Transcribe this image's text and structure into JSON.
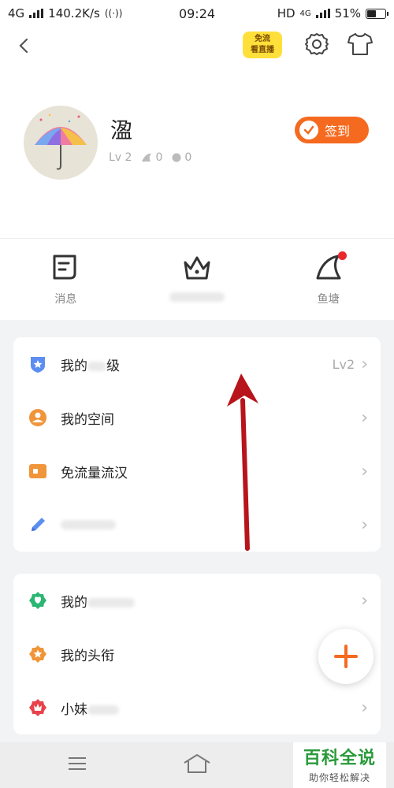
{
  "status_bar": {
    "network": "4G",
    "speed": "140.2K/s",
    "time": "09:24",
    "hd": "HD",
    "net_right": "4G",
    "battery": "51%",
    "battery_level": 0.51
  },
  "top_nav": {
    "badge_text_1": "免流",
    "badge_text_2": "看直播"
  },
  "profile": {
    "username": "溋",
    "level": "Lv 2",
    "stat_fish": "0",
    "stat_coin": "0",
    "checkin_label": "签到"
  },
  "quick_entries": [
    {
      "label": "消息",
      "icon": "message-icon"
    },
    {
      "label": "",
      "icon": "crown-icon"
    },
    {
      "label": "鱼塘",
      "icon": "shark-fin-icon"
    }
  ],
  "card1": [
    {
      "label": "我的",
      "label_tail": "级",
      "value": "Lv2",
      "icon": "shield-star-icon"
    },
    {
      "label": "我的空间",
      "value": "",
      "icon": "person-circle-icon"
    },
    {
      "label": "免流量流汉",
      "value": "",
      "icon": "ticket-icon"
    },
    {
      "label": "",
      "value": "",
      "icon": "pencil-icon"
    }
  ],
  "card2": [
    {
      "label": "我的",
      "value": "",
      "icon": "flower-badge-icon"
    },
    {
      "label": "我的头衔",
      "value": "",
      "icon": "medal-icon"
    },
    {
      "label": "小妹",
      "value": "",
      "icon": "crown-badge-icon"
    }
  ],
  "watermark": {
    "title": "百科全说",
    "subtitle": "助你轻松解决"
  },
  "colors": {
    "accent": "#f56a1e",
    "arrow": "#b8141b",
    "watermark": "#2a9a3a"
  }
}
